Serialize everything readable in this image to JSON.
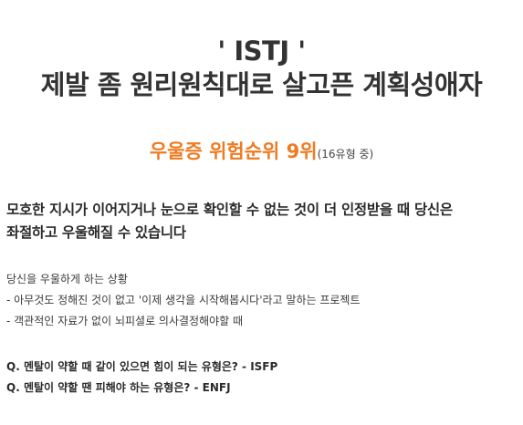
{
  "header": {
    "title_line1": "' ISTJ '",
    "title_line2": "제발 좀 원리원칙대로 살고픈 계획성애자"
  },
  "rank": {
    "label": "우울증 위험순위 9위",
    "note": "(16유형 중)"
  },
  "headline": {
    "line1": "모호한 지시가 이어지거나 눈으로 확인할 수 없는 것이 더 인정받을 때 당신은",
    "line2": "좌절하고 우울해질 수 있습니다"
  },
  "situations": {
    "heading": "당신을 우울하게 하는 상황",
    "items": [
      "- 아무것도 정해진 것이 없고 '이제 생각을 시작해봅시다'라고 말하는 프로젝트",
      "- 객관적인 자료가 없이 뇌피셜로 의사결정해야할 때"
    ]
  },
  "qa": [
    "Q. 멘탈이 약할 때 같이 있으면 힘이 되는 유형은? - ISFP",
    "Q. 멘탈이 약할 땐 피해야 하는 유형은? - ENFJ"
  ],
  "colors": {
    "accent": "#ee7b22",
    "text": "#2b2b2b"
  }
}
